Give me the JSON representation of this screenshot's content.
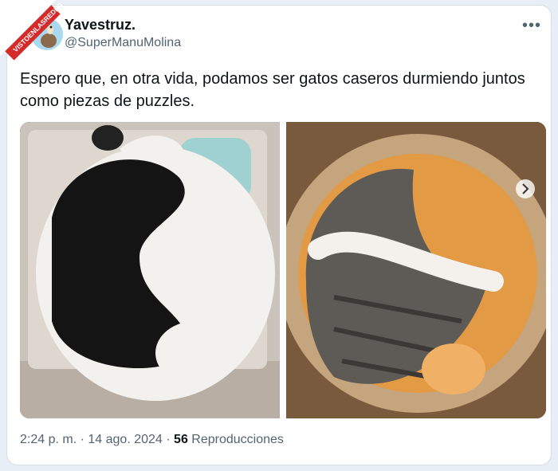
{
  "watermark": {
    "text": "VISTOENLASREDES"
  },
  "author": {
    "name": "Yavestruz.",
    "handle": "@SuperManuMolina"
  },
  "menu_icon": "more-horizontal-icon",
  "tweet_text": "Espero que, en otra vida, podamos ser gatos caseros durmiendo juntos como piezas de puzzles.",
  "media": {
    "left_image": "photo-black-white-cats-yin-yang",
    "right_image": "photo-tabby-orange-cats-in-basket",
    "nav_icon": "chevron-right-icon"
  },
  "meta": {
    "time": "2:24 p. m.",
    "separator1": "·",
    "date": "14 ago. 2024",
    "separator2": "·",
    "views_count": "56",
    "views_label": "Reproducciones"
  },
  "colors": {
    "background": "#e7eef5",
    "card": "#ffffff",
    "text": "#0f1419",
    "secondary": "#536471",
    "watermark": "#d42a2a"
  }
}
